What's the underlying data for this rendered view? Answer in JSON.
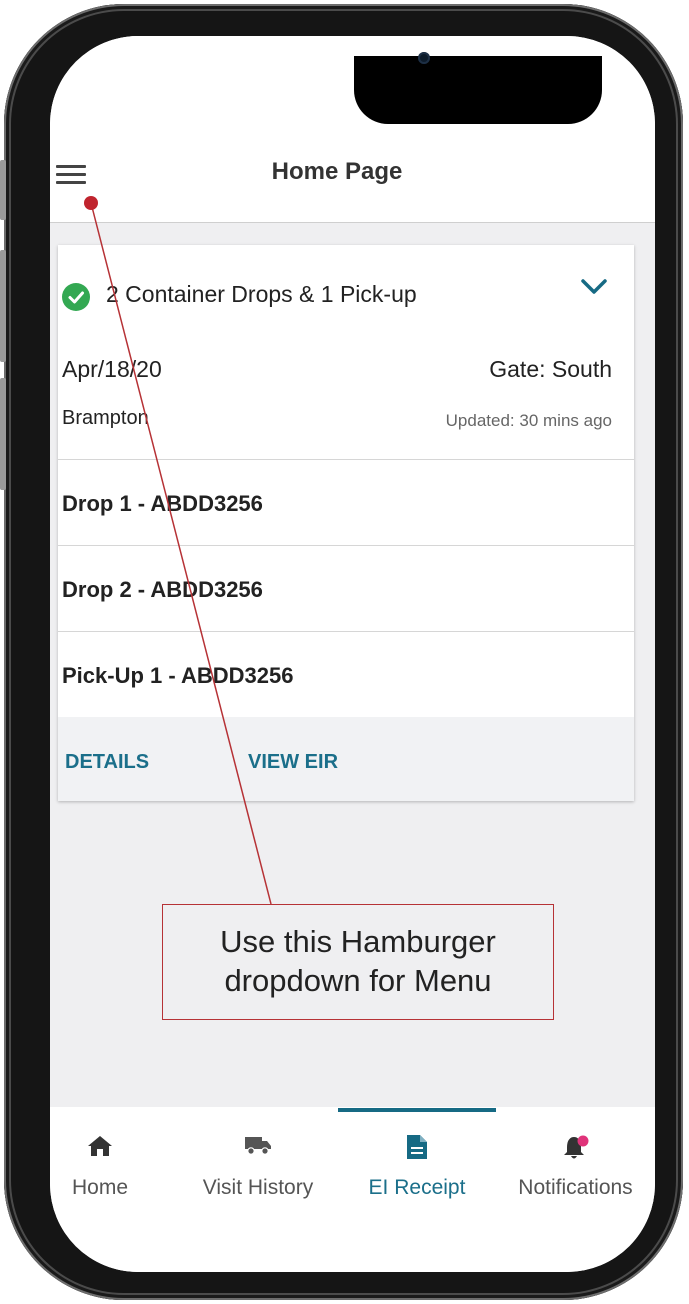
{
  "header": {
    "title": "Home Page"
  },
  "visit_card": {
    "title": "2 Container Drops & 1 Pick-up",
    "date": "Apr/18/20",
    "gate": "Gate: South",
    "location": "Brampton",
    "updated": "Updated: 30 mins ago",
    "rows": [
      {
        "label": "Drop 1 - ABDD3256"
      },
      {
        "label": "Drop 2 - ABDD3256"
      },
      {
        "label": "Pick-Up 1 - ABDD3256"
      }
    ],
    "actions": {
      "details": "DETAILS",
      "view_eir": "VIEW EIR"
    }
  },
  "annotation": {
    "line1": "Use this Hamburger",
    "line2": "dropdown for Menu"
  },
  "bottom_nav": {
    "active": "EI Receipt",
    "items": [
      {
        "label": "Home",
        "icon": "home-icon"
      },
      {
        "label": "Visit History",
        "icon": "truck-icon"
      },
      {
        "label": "EI Receipt",
        "icon": "document-icon"
      },
      {
        "label": "Notifications",
        "icon": "bell-icon"
      }
    ]
  },
  "colors": {
    "accent": "#1b6f8a",
    "success": "#33a852",
    "notification_badge": "#e0337a",
    "annotation": "#c0242e"
  }
}
